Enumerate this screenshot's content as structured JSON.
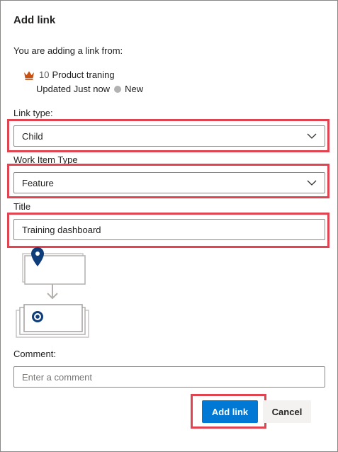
{
  "dialog": {
    "title": "Add link",
    "intro": "You are adding a link from:"
  },
  "work_item": {
    "icon": "crown-icon",
    "id": "10",
    "name": "Product traning",
    "updated": "Updated Just now",
    "state": "New",
    "state_color": "#b2b2b2",
    "icon_color": "#ca5010"
  },
  "fields": {
    "link_type": {
      "label": "Link type:",
      "value": "Child"
    },
    "work_item_type": {
      "label": "Work Item Type",
      "value": "Feature"
    },
    "title": {
      "label": "Title",
      "value": "Training dashboard"
    },
    "comment": {
      "label": "Comment:",
      "placeholder": "Enter a comment"
    }
  },
  "buttons": {
    "primary": "Add link",
    "secondary": "Cancel"
  },
  "colors": {
    "accent": "#0078d4",
    "highlight": "#e04451",
    "diagram_dark": "#0f3d7a"
  }
}
